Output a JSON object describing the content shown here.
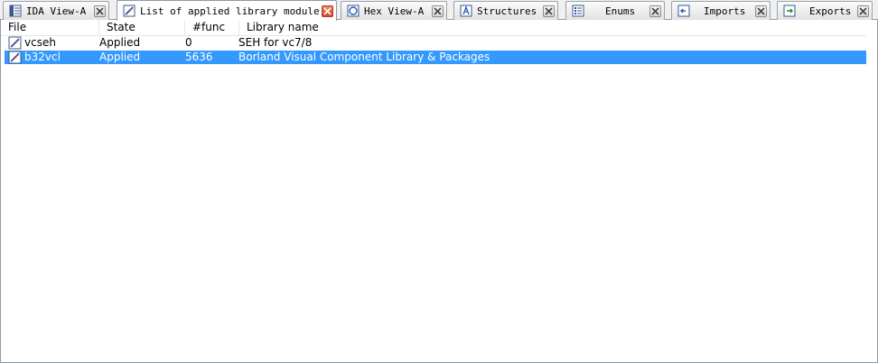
{
  "tabs": [
    {
      "label": "IDA View-A",
      "icon": "ida-view-icon",
      "active": false
    },
    {
      "label": "List of applied library modules",
      "icon": "library-modules-icon",
      "active": true
    },
    {
      "label": "Hex View-A",
      "icon": "hex-view-icon",
      "active": false
    },
    {
      "label": "Structures",
      "icon": "structures-icon",
      "active": false
    },
    {
      "label": "Enums",
      "icon": "enums-icon",
      "active": false
    },
    {
      "label": "Imports",
      "icon": "imports-icon",
      "active": false
    },
    {
      "label": "Exports",
      "icon": "exports-icon",
      "active": false
    }
  ],
  "table": {
    "columns": [
      "File",
      "State",
      "#func",
      "Library name"
    ],
    "rows": [
      {
        "file": "vcseh",
        "state": "Applied",
        "func": "0",
        "library": "SEH for vc7/8",
        "selected": false
      },
      {
        "file": "b32vcl",
        "state": "Applied",
        "func": "5636",
        "library": "Borland Visual Component Library & Packages",
        "selected": true
      }
    ]
  },
  "colors": {
    "selection": "#3399ff",
    "active_close": "#d2462a"
  }
}
